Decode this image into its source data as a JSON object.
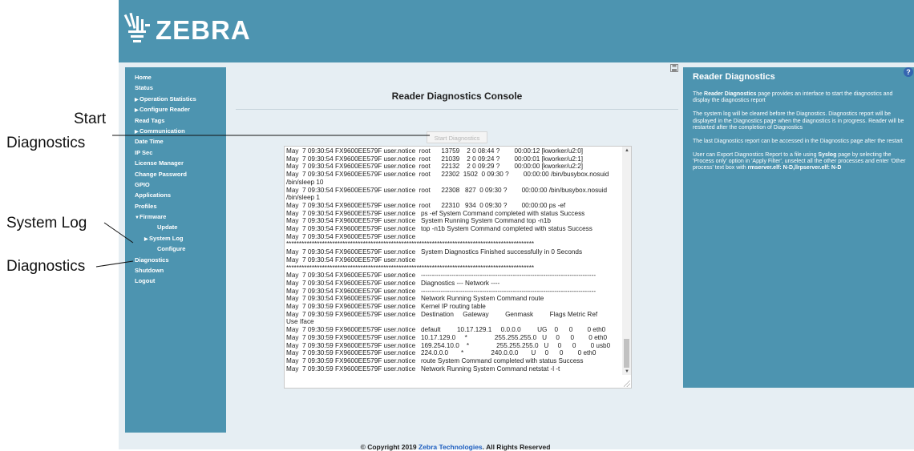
{
  "brand": {
    "logo_text": "ZEBRA"
  },
  "sidebar": {
    "items": [
      {
        "label": "Home",
        "level": 0,
        "arrow": ""
      },
      {
        "label": "Status",
        "level": 0,
        "arrow": ""
      },
      {
        "label": "Operation Statistics",
        "level": 0,
        "arrow": "▶"
      },
      {
        "label": "Configure Reader",
        "level": 0,
        "arrow": "▶"
      },
      {
        "label": "Read Tags",
        "level": 0,
        "arrow": ""
      },
      {
        "label": "Communication",
        "level": 0,
        "arrow": "▶"
      },
      {
        "label": "Date Time",
        "level": 0,
        "arrow": ""
      },
      {
        "label": "IP Sec",
        "level": 0,
        "arrow": ""
      },
      {
        "label": "License Manager",
        "level": 0,
        "arrow": ""
      },
      {
        "label": "Change Password",
        "level": 0,
        "arrow": ""
      },
      {
        "label": "GPIO",
        "level": 0,
        "arrow": ""
      },
      {
        "label": "Applications",
        "level": 0,
        "arrow": ""
      },
      {
        "label": "Profiles",
        "level": 0,
        "arrow": ""
      },
      {
        "label": "Firmware",
        "level": 0,
        "arrow": "▼"
      },
      {
        "label": "Update",
        "level": 2,
        "arrow": ""
      },
      {
        "label": "System Log",
        "level": 1,
        "arrow": "▶"
      },
      {
        "label": "Configure",
        "level": 2,
        "arrow": ""
      },
      {
        "label": "Diagnostics",
        "level": 0,
        "arrow": ""
      },
      {
        "label": "Shutdown",
        "level": 0,
        "arrow": ""
      },
      {
        "label": "Logout",
        "level": 0,
        "arrow": ""
      }
    ]
  },
  "main": {
    "title": "Reader Diagnostics Console",
    "start_button": "Start Diagnostics",
    "save_icon": "save-icon",
    "console_lines": [
      "May  7 09:30:54 FX9600EE579F user.notice  root      13759    2 0 08:44 ?        00:00:12 [kworker/u2:0]",
      "May  7 09:30:54 FX9600EE579F user.notice  root      21039    2 0 09:24 ?        00:00:01 [kworker/u2:1]",
      "May  7 09:30:54 FX9600EE579F user.notice  root      22132    2 0 09:29 ?        00:00:00 [kworker/u2:2]",
      "May  7 09:30:54 FX9600EE579F user.notice  root      22302  1502  0 09:30 ?        00:00:00 /bin/busybox.nosuid",
      "/bin/sleep 10",
      "May  7 09:30:54 FX9600EE579F user.notice  root      22308   827  0 09:30 ?        00:00:00 /bin/busybox.nosuid",
      "/bin/sleep 1",
      "May  7 09:30:54 FX9600EE579F user.notice  root      22310   934  0 09:30 ?        00:00:00 ps -ef",
      "May  7 09:30:54 FX9600EE579F user.notice   ps -ef System Command completed with status Success",
      "May  7 09:30:54 FX9600EE579F user.notice   System Running System Command top -n1b",
      "May  7 09:30:54 FX9600EE579F user.notice   top -n1b System Command completed with status Success",
      "May  7 09:30:54 FX9600EE579F user.notice",
      "*************************************************************************************************",
      "May  7 09:30:54 FX9600EE579F user.notice   System Diagnostics Finished successfully in 0 Seconds",
      "May  7 09:30:54 FX9600EE579F user.notice",
      "*************************************************************************************************",
      "May  7 09:30:54 FX9600EE579F user.notice   --------------------------------------------------------------------------------",
      "May  7 09:30:54 FX9600EE579F user.notice   Diagnostics --- Network ----",
      "May  7 09:30:54 FX9600EE579F user.notice   --------------------------------------------------------------------------------",
      "May  7 09:30:54 FX9600EE579F user.notice   Network Running System Command route",
      "May  7 09:30:59 FX9600EE579F user.notice   Kernel IP routing table",
      "May  7 09:30:59 FX9600EE579F user.notice   Destination     Gateway         Genmask         Flags Metric Ref",
      "Use Iface",
      "May  7 09:30:59 FX9600EE579F user.notice   default         10.17.129.1     0.0.0.0         UG    0      0        0 eth0",
      "May  7 09:30:59 FX9600EE579F user.notice   10.17.129.0     *               255.255.255.0   U     0      0        0 eth0",
      "May  7 09:30:59 FX9600EE579F user.notice   169.254.10.0    *               255.255.255.0   U     0      0        0 usb0",
      "May  7 09:30:59 FX9600EE579F user.notice   224.0.0.0       *               240.0.0.0       U     0      0        0 eth0",
      "May  7 09:30:59 FX9600EE579F user.notice   route System Command completed with status Success",
      "May  7 09:30:59 FX9600EE579F user.notice   Network Running System Command netstat -l -t"
    ]
  },
  "help": {
    "title": "Reader Diagnostics",
    "p1_pre": "The ",
    "p1_bold": "Reader Diagnostics",
    "p1_post": " page provides an interface to start the diagnostics and display the diagnostics report",
    "p2": "The system log will be cleared before the Diagnostics. Diagnostics report will be displayed in the Diagnostics page when the diagnostics is in progress. Reader will be restarted after the completion of Diagnostics",
    "p3": "The last Diagnostics report can be accessed in the Diagnostics page after the restart",
    "p4_pre": "User can Export Diagnostics Report to a file using ",
    "p4_bold1": "Syslog",
    "p4_mid": " page by selecting the 'Process only' option in 'Apply Filter', unselect all the other processes and enter 'Other process' text box with ",
    "p4_bold2": "rmserver.elf: N-D,llrpserver.elf: N-D"
  },
  "footer": {
    "copyright": "© Copyright 2019 ",
    "link": "Zebra Technologies",
    "rights": ". All Rights Reserved"
  },
  "annotations": {
    "start_line1": "Start",
    "start_line2": "Diagnostics",
    "system_log": "System Log",
    "diagnostics": "Diagnostics"
  }
}
